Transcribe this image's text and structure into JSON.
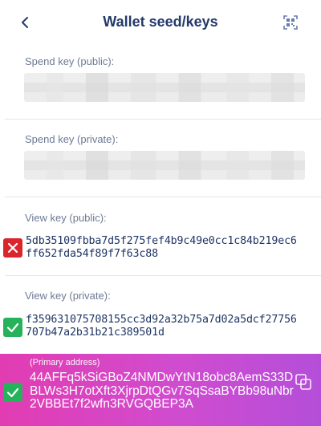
{
  "header": {
    "title": "Wallet seed/keys",
    "back_icon": "chevron-left-icon",
    "qr_icon": "qr-scan-icon"
  },
  "sections": {
    "spend_public": {
      "label": "Spend key (public):"
    },
    "spend_private": {
      "label": "Spend key (private):"
    },
    "view_public": {
      "label": "View key (public):",
      "value": "5db35109fbba7d5f275fef4b9c49e0cc1c84b219ec6ff652fda54f89f7f63c88",
      "status": "invalid"
    },
    "view_private": {
      "label": "View key (private):",
      "value": "f359631075708155cc3d92a32b75a7d02a5dcf27756707b47a2b31b21c389501d",
      "status": "valid"
    }
  },
  "primary": {
    "label": "(Primary address)",
    "address": "44AFFq5kSiGBoZ4NMDwYtN18obc8AemS33DBLWs3H7otXft3XjrpDtQGv7SqSsaBYBb98uNbr2VBBEt7f2wfn3RVGQBEP3A",
    "status": "valid",
    "copy_icon": "copy-icon"
  },
  "colors": {
    "title": "#243a6a",
    "label": "#6d7a93",
    "invalid": "#d9252b",
    "valid": "#26b25a",
    "primary_gradient_start": "#e23cb2",
    "primary_gradient_end": "#b44ed9"
  }
}
